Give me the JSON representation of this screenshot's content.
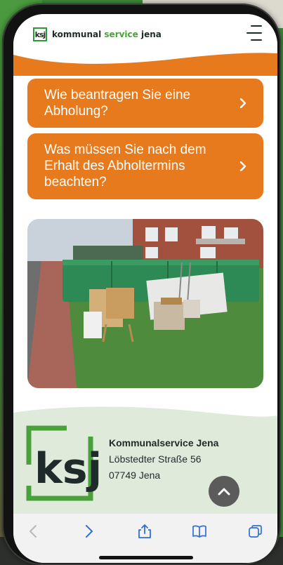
{
  "header": {
    "logo_letters": "ksj",
    "brand_part1": "kommunal",
    "brand_part2": "service",
    "brand_part3": "jena",
    "menu_icon": "hamburger-menu-icon"
  },
  "accordion": [
    {
      "label": "Wie beantragen Sie eine Abholung?"
    },
    {
      "label": "Was müssen Sie nach dem Erhalt des Abholtermins beachten?"
    }
  ],
  "photo": {
    "description_icon": "bulky-waste-photo"
  },
  "footer": {
    "logo_letters": "ksj",
    "name": "Kommunalservice Jena",
    "street": "Löbstedter Straße 56",
    "city": "07749 Jena"
  },
  "colors": {
    "accent_orange": "#e87a1e",
    "brand_green": "#4aa13b",
    "footer_bg": "#dfeadb",
    "dark": "#1f2a2a"
  },
  "toolbar": {
    "back_icon": "chevron-left-icon",
    "forward_icon": "chevron-right-icon",
    "share_icon": "share-icon",
    "bookmarks_icon": "book-icon",
    "tabs_icon": "tabs-icon"
  }
}
